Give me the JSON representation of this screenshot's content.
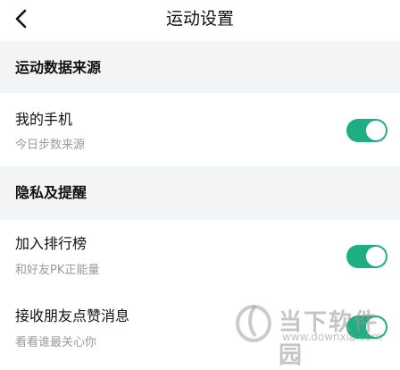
{
  "header": {
    "title": "运动设置"
  },
  "sections": [
    {
      "label": "运动数据来源",
      "rows": [
        {
          "title": "我的手机",
          "subtitle": "今日步数来源",
          "toggle_on": true
        }
      ]
    },
    {
      "label": "隐私及提醒",
      "rows": [
        {
          "title": "加入排行榜",
          "subtitle": "和好友PK正能量",
          "toggle_on": true
        },
        {
          "title": "接收朋友点赞消息",
          "subtitle": "看看谁最关心你",
          "toggle_on": true
        }
      ]
    }
  ],
  "colors": {
    "accent": "#1fae83",
    "section_bg": "#f3f4f6"
  },
  "watermark": {
    "text": "当下软件园",
    "url": "www.downxia.com"
  }
}
